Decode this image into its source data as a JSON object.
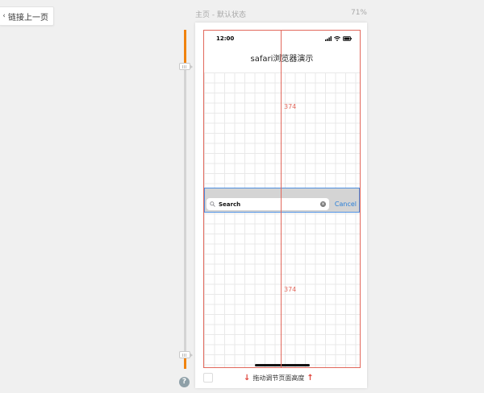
{
  "back_link": {
    "label": "链接上一页",
    "icon": "chevron-left-icon"
  },
  "page_info": {
    "title": "主页 - 默认状态",
    "zoom": "71%"
  },
  "phone": {
    "status_bar": {
      "time": "12:00",
      "icons": [
        "signal-icon",
        "wifi-icon",
        "battery-icon"
      ]
    },
    "nav_title": "safari浏览器演示",
    "search": {
      "placeholder": "Search",
      "cancel_label": "Cancel",
      "clear_icon": "clear-icon"
    }
  },
  "measurements": {
    "top": "374",
    "bottom": "374"
  },
  "footer": {
    "hint": "拖动调节页面高度"
  },
  "help": {
    "label": "?"
  },
  "colors": {
    "accent": "#f0830f",
    "guide": "#e2685c",
    "selection": "#4d8fe0",
    "link": "#2a7fd8",
    "arrow": "#e0453c"
  }
}
